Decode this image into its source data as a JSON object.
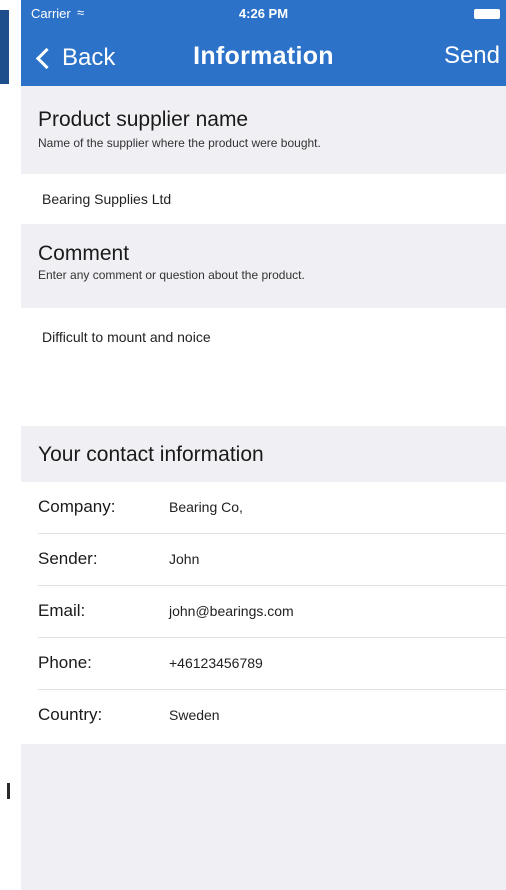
{
  "status_bar": {
    "carrier": "Carrier",
    "time": "4:26 PM"
  },
  "nav": {
    "back_label": "Back",
    "title": "Information",
    "send_label": "Send"
  },
  "supplier": {
    "title": "Product supplier name",
    "subtitle": "Name of the supplier where the product were bought.",
    "value": "Bearing Supplies Ltd"
  },
  "comment": {
    "title": "Comment",
    "subtitle": "Enter any comment or question about the product.",
    "value": "Difficult to mount and noice"
  },
  "contact": {
    "title": "Your contact information",
    "rows": [
      {
        "label": "Company:",
        "value": "Bearing Co,"
      },
      {
        "label": "Sender:",
        "value": "John"
      },
      {
        "label": "Email:",
        "value": "john@bearings.com"
      },
      {
        "label": "Phone:",
        "value": "+46123456789"
      },
      {
        "label": "Country:",
        "value": "Sweden"
      }
    ]
  },
  "colors": {
    "nav_background": "#2b72c8",
    "page_background": "#efeff4",
    "field_background": "#ffffff"
  }
}
